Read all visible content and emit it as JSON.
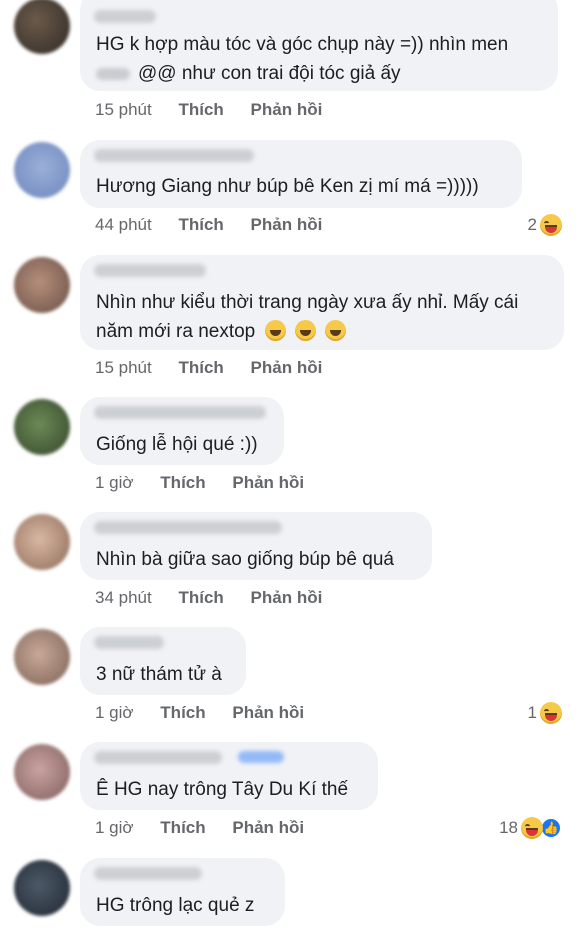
{
  "comments": [
    {
      "line1": "HG k hợp màu tóc và góc chụp này =)) nhìn men",
      "line2": "@@ như con trai đội tóc giả ấy",
      "time": "15 phút",
      "like": "Thích",
      "reply": "Phản hồi"
    },
    {
      "line1": "Hương Giang như búp bê Ken zị mí má =)))))",
      "time": "44 phút",
      "like": "Thích",
      "reply": "Phản hồi",
      "reaction_count": "2",
      "reaction_icon": "laugh-emoji"
    },
    {
      "line1": "Nhìn như kiểu thời trang ngày xưa ấy nhỉ. Mấy cái",
      "line2": "năm mới ra nextop",
      "time": "15 phút",
      "like": "Thích",
      "reply": "Phản hồi"
    },
    {
      "line1": "Giống lễ hội qué :))",
      "time": "1 giờ",
      "like": "Thích",
      "reply": "Phản hồi"
    },
    {
      "line1": "Nhìn bà giữa sao giống búp bê quá",
      "time": "34 phút",
      "like": "Thích",
      "reply": "Phản hồi"
    },
    {
      "line1": "3 nữ thám tử à",
      "time": "1 giờ",
      "like": "Thích",
      "reply": "Phản hồi",
      "reaction_count": "1",
      "reaction_icon": "laugh-emoji"
    },
    {
      "line1": "Ê HG nay trông Tây Du Kí thế",
      "time": "1 giờ",
      "like": "Thích",
      "reply": "Phản hồi",
      "reaction_count": "18",
      "reaction_icon": "laugh-and-like"
    },
    {
      "line1": "HG trông lạc quẻ z"
    }
  ],
  "colors": {
    "bubble": "#f0f2f5",
    "meta_text": "#65676b",
    "like_blue": "#1877f2"
  }
}
